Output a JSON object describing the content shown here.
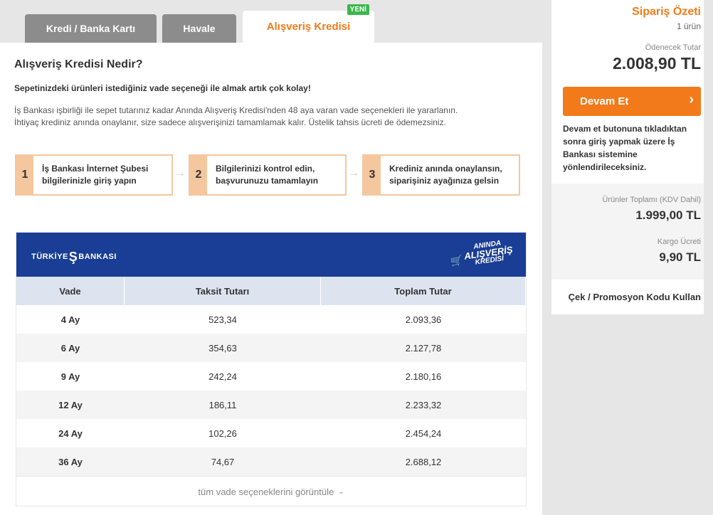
{
  "tabs": [
    {
      "label": "Kredi / Banka Kartı"
    },
    {
      "label": "Havale"
    },
    {
      "label": "Alışveriş Kredisi",
      "badge": "YENİ"
    }
  ],
  "main": {
    "title": "Alışveriş Kredisi Nedir?",
    "subtitle": "Sepetinizdeki ürünleri istediğiniz vade seçeneği ile almak artık çok kolay!",
    "desc1": "İş Bankası işbirliği ile sepet tutarınız kadar Anında Alışveriş Kredisi'nden 48 aya varan vade seçenekleri ile yararlanın.",
    "desc2": "İhtiyaç krediniz anında onaylanır, size sadece alışverişinizi tamamlamak kalır. Üstelik tahsis ücreti de ödemezsiniz.",
    "steps": [
      {
        "num": "1",
        "line1": "İş Bankası İnternet Şubesi",
        "line2": "bilgilerinizle giriş yapın"
      },
      {
        "num": "2",
        "line1": "Bilgilerinizi kontrol edin,",
        "line2": "başvurunuzu tamamlayın"
      },
      {
        "num": "3",
        "line1": "Krediniz anında onaylansın,",
        "line2": "siparişiniz ayağınıza gelsin"
      }
    ]
  },
  "bank": {
    "logo_left": "TÜRKİYE",
    "logo_mark": "Ş",
    "logo_right": "BANKASI",
    "credit_logo": {
      "l1": "ANINDA",
      "l2": "ALIŞVERİŞ",
      "l3": "KREDİSİ"
    },
    "columns": [
      "Vade",
      "Taksit Tutarı",
      "Toplam Tutar"
    ],
    "rows": [
      {
        "vade": "4 Ay",
        "taksit": "523,34",
        "toplam": "2.093,36"
      },
      {
        "vade": "6 Ay",
        "taksit": "354,63",
        "toplam": "2.127,78"
      },
      {
        "vade": "9 Ay",
        "taksit": "242,24",
        "toplam": "2.180,16"
      },
      {
        "vade": "12 Ay",
        "taksit": "186,11",
        "toplam": "2.233,32"
      },
      {
        "vade": "24 Ay",
        "taksit": "102,26",
        "toplam": "2.454,24"
      },
      {
        "vade": "36 Ay",
        "taksit": "74,67",
        "toplam": "2.688,12"
      }
    ],
    "more_label": "tüm vade seçeneklerini görüntüle"
  },
  "summary": {
    "title": "Sipariş Özeti",
    "count": "1 ürün",
    "payable_label": "Ödenecek Tutar",
    "payable": "2.008,90 TL",
    "button": "Devam Et",
    "info": "Devam et butonuna tıkladıktan sonra giriş yapmak üzere İş Bankası sistemine yönlendirileceksiniz.",
    "products_label": "Ürünler Toplamı (KDV Dahil)",
    "products": "1.999,00 TL",
    "cargo_label": "Kargo Ücreti",
    "cargo": "9,90 TL",
    "promo": "Çek / Promosyon Kodu Kullan"
  }
}
